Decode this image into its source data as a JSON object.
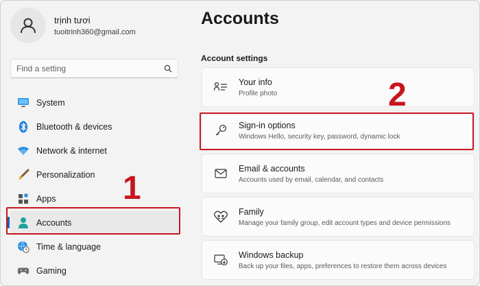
{
  "user": {
    "name": "trịnh tươi",
    "email": "tuoitrinh360@gmail.com"
  },
  "search": {
    "placeholder": "Find a setting"
  },
  "nav": [
    {
      "label": "System",
      "icon": "monitor-icon"
    },
    {
      "label": "Bluetooth & devices",
      "icon": "bluetooth-icon"
    },
    {
      "label": "Network & internet",
      "icon": "wifi-icon"
    },
    {
      "label": "Personalization",
      "icon": "brush-icon"
    },
    {
      "label": "Apps",
      "icon": "apps-icon"
    },
    {
      "label": "Accounts",
      "icon": "person-icon",
      "active": true
    },
    {
      "label": "Time & language",
      "icon": "globe-clock-icon"
    },
    {
      "label": "Gaming",
      "icon": "gamepad-icon"
    }
  ],
  "page": {
    "title": "Accounts",
    "section": "Account settings"
  },
  "cards": [
    {
      "title": "Your info",
      "subtitle": "Profile photo",
      "icon": "person-info-icon"
    },
    {
      "title": "Sign-in options",
      "subtitle": "Windows Hello, security key, password, dynamic lock",
      "icon": "key-icon"
    },
    {
      "title": "Email & accounts",
      "subtitle": "Accounts used by email, calendar, and contacts",
      "icon": "mail-icon"
    },
    {
      "title": "Family",
      "subtitle": "Manage your family group, edit account types and device permissions",
      "icon": "family-heart-icon"
    },
    {
      "title": "Windows backup",
      "subtitle": "Back up your files, apps, preferences to restore them across devices",
      "icon": "backup-icon"
    }
  ],
  "annotations": {
    "step1": "1",
    "step2": "2",
    "color": "#c8151d"
  },
  "colors": {
    "accent": "#0067c0"
  }
}
